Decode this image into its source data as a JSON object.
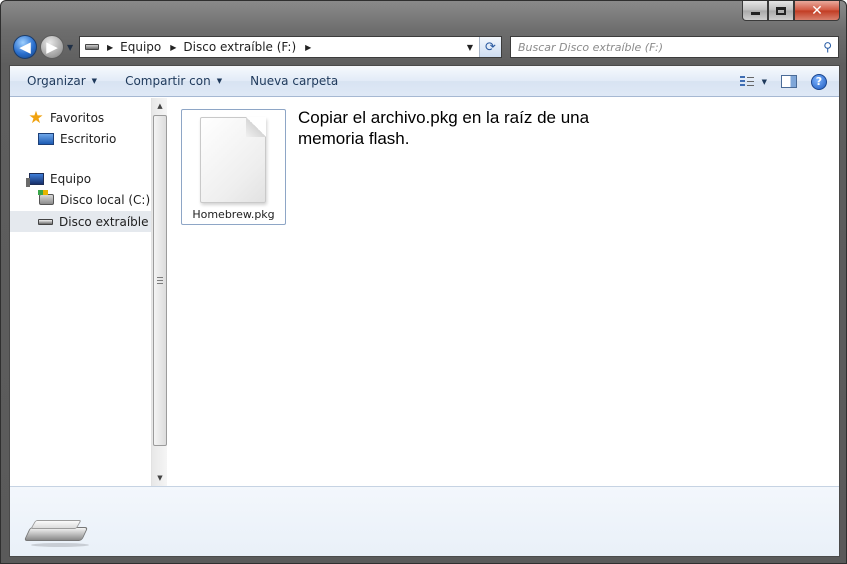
{
  "window": {
    "minimize_glyph": "",
    "maximize_glyph": "",
    "close_glyph": "✕"
  },
  "nav": {
    "back_glyph": "◀",
    "forward_glyph": "▶",
    "history_dropdown_glyph": "▼"
  },
  "address": {
    "breadcrumbs": [
      "Equipo",
      "Disco extraíble (F:)"
    ],
    "separator_glyph": "▶",
    "dropdown_glyph": "▼",
    "refresh_glyph": "⟳"
  },
  "search": {
    "placeholder": "Buscar Disco extraíble (F:)",
    "icon": "search-icon",
    "icon_glyph": "⚲"
  },
  "toolbar": {
    "organize_label": "Organizar",
    "share_label": "Compartir con",
    "new_folder_label": "Nueva carpeta",
    "dropdown_glyph": "▼",
    "help_glyph": "?"
  },
  "sidebar": {
    "items": [
      {
        "label": "Favoritos",
        "icon": "star-icon"
      },
      {
        "label": "Escritorio",
        "icon": "desktop-icon"
      },
      {
        "label": "Equipo",
        "icon": "computer-icon"
      },
      {
        "label": "Disco local (C:)",
        "icon": "hard-drive-icon"
      },
      {
        "label": "Disco extraíble (F:)",
        "icon": "removable-drive-icon",
        "selected": true
      }
    ]
  },
  "scrollbar": {
    "up_glyph": "▲",
    "down_glyph": "▼"
  },
  "files": [
    {
      "name": "Homebrew.pkg",
      "icon": "document-icon"
    }
  ],
  "annotation": {
    "text": "Copiar el archivo.pkg en la raíz de una memoria flash."
  },
  "colors": {
    "toolbar_text": "#1e395b",
    "selection_border": "#8ea6c6",
    "window_chrome": "#6d6d6d"
  }
}
